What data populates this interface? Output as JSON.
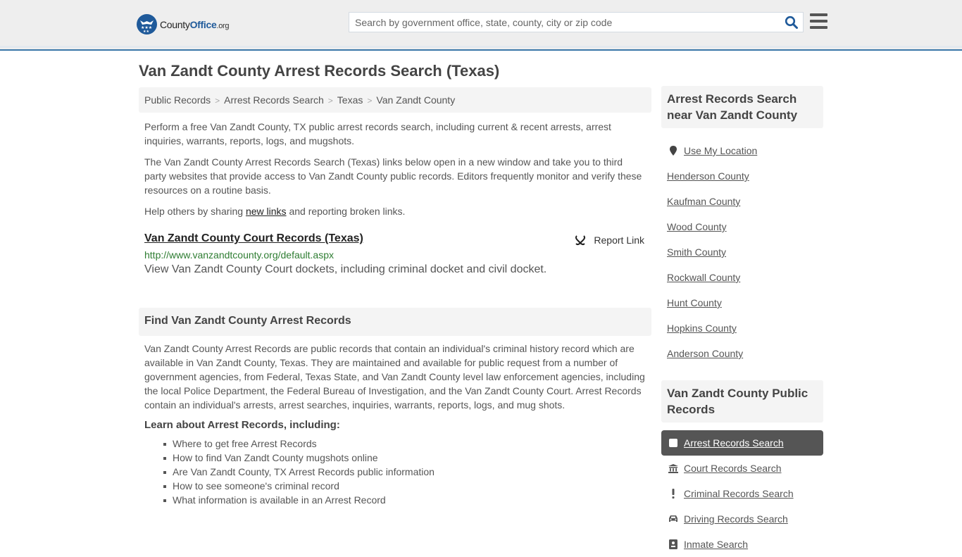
{
  "header": {
    "logo_county": "County",
    "logo_office": "Office",
    "logo_org": ".org",
    "search_placeholder": "Search by government office, state, county, city or zip code",
    "search_value": ""
  },
  "page": {
    "title": "Van Zandt County Arrest Records Search (Texas)"
  },
  "breadcrumb": [
    {
      "label": "Public Records"
    },
    {
      "label": "Arrest Records Search"
    },
    {
      "label": "Texas"
    },
    {
      "label": "Van Zandt County"
    }
  ],
  "intro": {
    "p1": "Perform a free Van Zandt County, TX public arrest records search, including current & recent arrests, arrest inquiries, warrants, reports, logs, and mugshots.",
    "p2": "The Van Zandt County Arrest Records Search (Texas) links below open in a new window and take you to third party websites that provide access to Van Zandt County public records. Editors frequently monitor and verify these resources on a routine basis.",
    "p3_before": "Help others by sharing ",
    "p3_link": "new links",
    "p3_after": " and reporting broken links."
  },
  "record": {
    "title": "Van Zandt County Court Records (Texas)",
    "report_label": "Report Link",
    "url": "http://www.vanzandtcounty.org/default.aspx",
    "description": "View Van Zandt County Court dockets, including criminal docket and civil docket."
  },
  "find_section": {
    "heading": "Find Van Zandt County Arrest Records",
    "body": "Van Zandt County Arrest Records are public records that contain an individual's criminal history record which are available in Van Zandt County, Texas. They are maintained and available for public request from a number of government agencies, from Federal, Texas State, and Van Zandt County level law enforcement agencies, including the local Police Department, the Federal Bureau of Investigation, and the Van Zandt County Court. Arrest Records contain an individual's arrests, arrest searches, inquiries, warrants, reports, logs, and mug shots.",
    "learn_heading": "Learn about Arrest Records, including:",
    "learn_items": [
      "Where to get free Arrest Records",
      "How to find Van Zandt County mugshots online",
      "Are Van Zandt County, TX Arrest Records public information",
      "How to see someone's criminal record",
      "What information is available in an Arrest Record"
    ]
  },
  "sidebar": {
    "nearby_heading": "Arrest Records Search near Van Zandt County",
    "use_location": "Use My Location",
    "nearby": [
      "Henderson County",
      "Kaufman County",
      "Wood County",
      "Smith County",
      "Rockwall County",
      "Hunt County",
      "Hopkins County",
      "Anderson County"
    ],
    "public_records_heading": "Van Zandt County Public Records",
    "public_records": [
      {
        "label": "Arrest Records Search",
        "icon": "square-icon",
        "active": true
      },
      {
        "label": "Court Records Search",
        "icon": "courthouse-icon",
        "active": false
      },
      {
        "label": "Criminal Records Search",
        "icon": "exclamation-icon",
        "active": false
      },
      {
        "label": "Driving Records Search",
        "icon": "car-icon",
        "active": false
      },
      {
        "label": "Inmate Search",
        "icon": "id-card-icon",
        "active": false
      }
    ]
  },
  "colors": {
    "brand_blue": "#1f5a9a",
    "header_border": "#3a77a8",
    "url_green": "#2e7d32",
    "active_item_bg": "#555555"
  }
}
